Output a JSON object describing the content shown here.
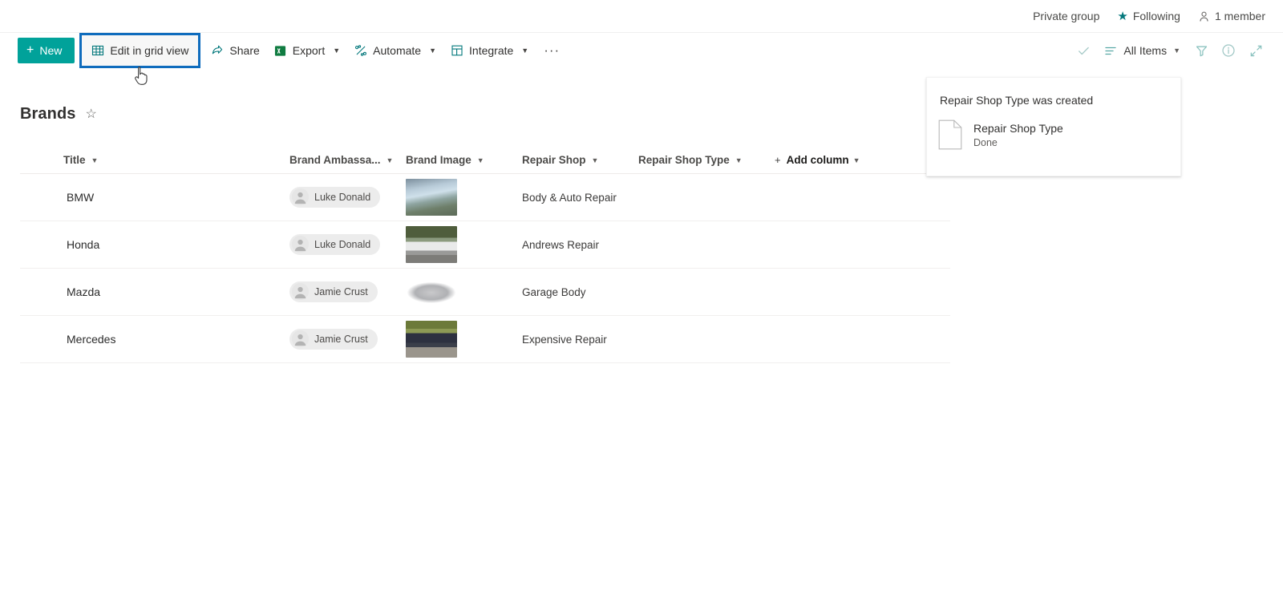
{
  "site_header": {
    "privacy_label": "Private group",
    "following_label": "Following",
    "members_label": "1 member",
    "star_icon": "star-filled-icon",
    "person_icon": "person-icon"
  },
  "command_bar": {
    "new_label": "New",
    "new_icon": "plus-icon",
    "new_color": "#01a29a",
    "focus_ring_color": "#0f6cbd",
    "items": [
      {
        "label": "Edit in grid view",
        "icon": "grid-table-icon",
        "has_chevron": false,
        "focused": true
      },
      {
        "label": "Share",
        "icon": "share-icon",
        "has_chevron": false,
        "focused": false
      },
      {
        "label": "Export",
        "icon": "excel-icon",
        "has_chevron": true,
        "focused": false
      },
      {
        "label": "Automate",
        "icon": "automate-flow-icon",
        "has_chevron": true,
        "focused": false
      },
      {
        "label": "Integrate",
        "icon": "integrate-icon",
        "has_chevron": true,
        "focused": false
      }
    ],
    "overflow_label": "···",
    "overflow_icon": "ellipsis-icon",
    "right": {
      "checkmark_icon": "checkmark-icon",
      "view_icon": "list-view-icon",
      "view_label": "All Items",
      "view_chevron": "chevron-down-icon",
      "filter_icon": "filter-funnel-icon",
      "info_icon": "info-circle-icon",
      "expand_icon": "expand-diagonal-icon"
    }
  },
  "list": {
    "title": "Brands",
    "favorite_icon": "star-outline-icon",
    "columns": [
      {
        "label": "Title",
        "chevron": "chevron-down-icon"
      },
      {
        "label": "Brand Ambassa...",
        "chevron": "chevron-down-icon"
      },
      {
        "label": "Brand Image",
        "chevron": "chevron-down-icon"
      },
      {
        "label": "Repair Shop",
        "chevron": "chevron-down-icon"
      },
      {
        "label": "Repair Shop Type",
        "chevron": "chevron-down-icon"
      }
    ],
    "add_column_label": "Add column",
    "add_column_icon": "plus-icon",
    "add_column_chevron": "chevron-down-icon",
    "rows": [
      {
        "title": "BMW",
        "new_indicator_icon": "new-sparkle-icon",
        "ambassador": "Luke Donald",
        "avatar_icon": "person-avatar-icon",
        "image_alt": "silver-bmw-on-coastal-road",
        "repair_shop": "Body & Auto Repair",
        "repair_shop_type": ""
      },
      {
        "title": "Honda",
        "new_indicator_icon": "new-sparkle-icon",
        "ambassador": "Luke Donald",
        "avatar_icon": "person-avatar-icon",
        "image_alt": "white-honda-sedan-side-view",
        "repair_shop": "Andrews Repair",
        "repair_shop_type": ""
      },
      {
        "title": "Mazda",
        "new_indicator_icon": "new-sparkle-icon",
        "ambassador": "Jamie Crust",
        "avatar_icon": "person-avatar-icon",
        "image_alt": "silver-mazda-on-white-background",
        "repair_shop": "Garage Body",
        "repair_shop_type": ""
      },
      {
        "title": "Mercedes",
        "new_indicator_icon": "new-sparkle-icon",
        "ambassador": "Jamie Crust",
        "avatar_icon": "person-avatar-icon",
        "image_alt": "dark-mercedes-on-forest-road",
        "repair_shop": "Expensive Repair",
        "repair_shop_type": ""
      }
    ]
  },
  "flyout": {
    "title": "Repair Shop Type was created",
    "item_icon": "document-page-icon",
    "item_name": "Repair Shop Type",
    "item_status": "Done"
  }
}
